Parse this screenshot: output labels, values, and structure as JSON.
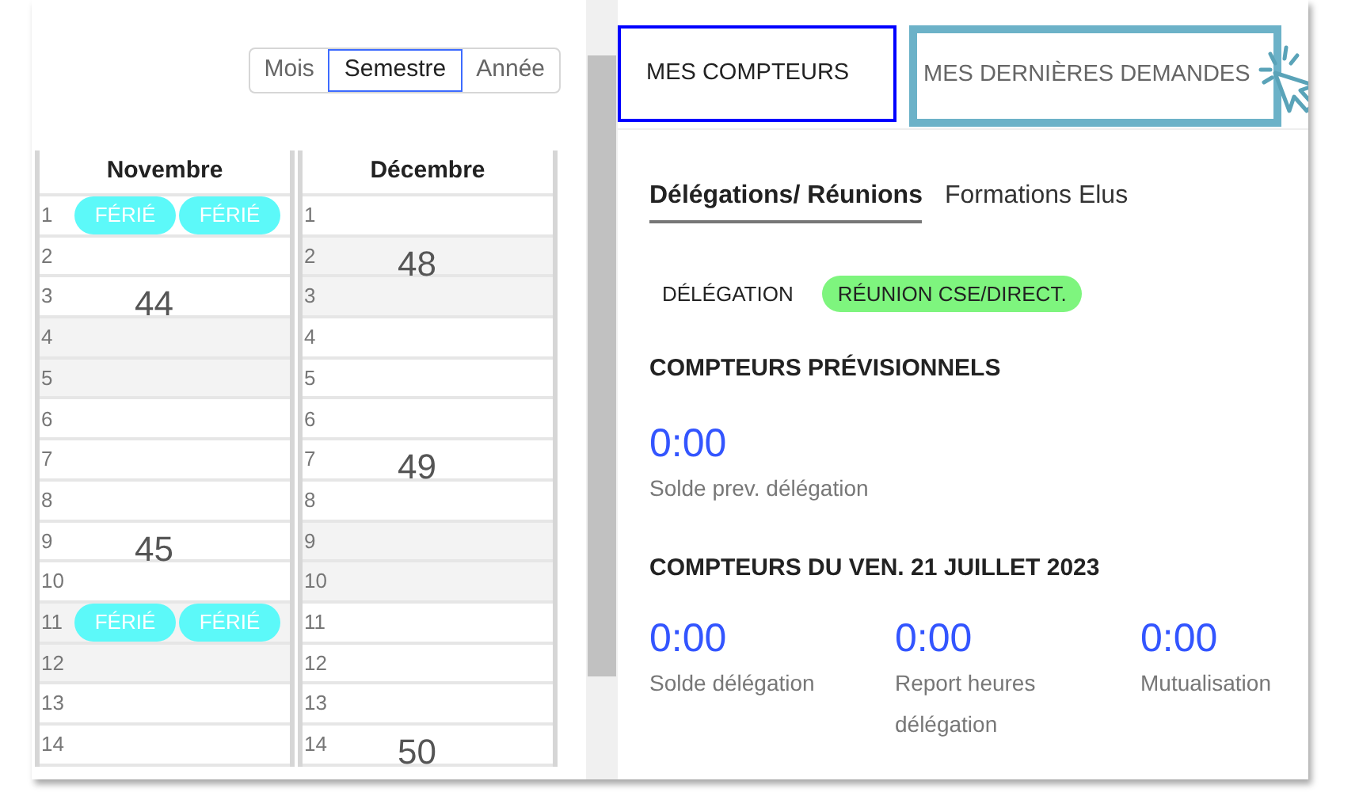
{
  "period_switch": [
    {
      "label": "Mois",
      "selected": false
    },
    {
      "label": "Semestre",
      "selected": true
    },
    {
      "label": "Année",
      "selected": false
    }
  ],
  "calendar": {
    "months": [
      {
        "name": "Novembre",
        "days": [
          {
            "day": "1",
            "weekend": false,
            "events": [
              "FÉRIÉ",
              "FÉRIÉ"
            ]
          },
          {
            "day": "2",
            "weekend": false
          },
          {
            "day": "3",
            "weekend": false,
            "week": "44"
          },
          {
            "day": "4",
            "weekend": true
          },
          {
            "day": "5",
            "weekend": true
          },
          {
            "day": "6",
            "weekend": false
          },
          {
            "day": "7",
            "weekend": false
          },
          {
            "day": "8",
            "weekend": false
          },
          {
            "day": "9",
            "weekend": false,
            "week": "45"
          },
          {
            "day": "10",
            "weekend": false
          },
          {
            "day": "11",
            "weekend": true,
            "events": [
              "FÉRIÉ",
              "FÉRIÉ"
            ]
          },
          {
            "day": "12",
            "weekend": true
          },
          {
            "day": "13",
            "weekend": false
          },
          {
            "day": "14",
            "weekend": false
          }
        ]
      },
      {
        "name": "Décembre",
        "days": [
          {
            "day": "1",
            "weekend": false
          },
          {
            "day": "2",
            "weekend": true,
            "week": "48"
          },
          {
            "day": "3",
            "weekend": true
          },
          {
            "day": "4",
            "weekend": false
          },
          {
            "day": "5",
            "weekend": false
          },
          {
            "day": "6",
            "weekend": false
          },
          {
            "day": "7",
            "weekend": false,
            "week": "49"
          },
          {
            "day": "8",
            "weekend": false
          },
          {
            "day": "9",
            "weekend": true
          },
          {
            "day": "10",
            "weekend": true
          },
          {
            "day": "11",
            "weekend": false
          },
          {
            "day": "12",
            "weekend": false
          },
          {
            "day": "13",
            "weekend": false
          },
          {
            "day": "14",
            "weekend": false,
            "week": "50"
          }
        ]
      }
    ]
  },
  "tabs": [
    {
      "label": "MES COMPTEURS",
      "selected": true,
      "annotated": false
    },
    {
      "label": "MES DERNIÈRES DEMANDES",
      "selected": false,
      "annotated": true
    }
  ],
  "subtabs": [
    {
      "label": "Délégations/ Réunions",
      "selected": true
    },
    {
      "label": "Formations Elus",
      "selected": false
    }
  ],
  "filters": [
    {
      "label": "DÉLÉGATION",
      "selected": false
    },
    {
      "label": "RÉUNION CSE/DIRECT.",
      "selected": true
    }
  ],
  "sections": [
    {
      "title": "COMPTEURS PRÉVISIONNELS",
      "counters": [
        {
          "value": "0:00",
          "label": "Solde prev. délégation"
        }
      ]
    },
    {
      "title": "COMPTEURS DU VEN. 21 JUILLET 2023",
      "counters": [
        {
          "value": "0:00",
          "label": "Solde délégation"
        },
        {
          "value": "0:00",
          "label": "Report heures délégation"
        },
        {
          "value": "0:00",
          "label": "Mutualisation"
        }
      ]
    }
  ]
}
